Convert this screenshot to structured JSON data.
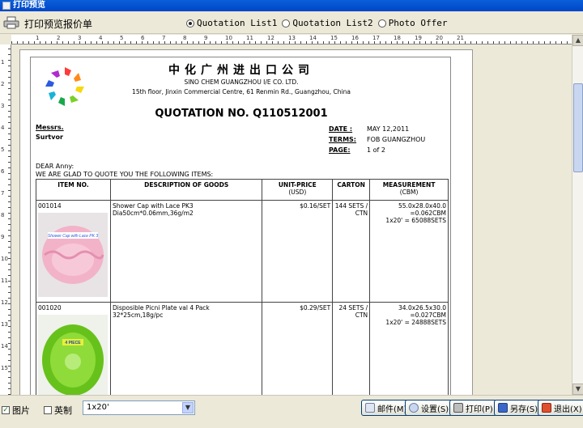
{
  "window": {
    "title": "打印预览"
  },
  "toolbar": {
    "app_label": "打印预览报价单",
    "options": [
      {
        "label": "Quotation List1",
        "selected": true
      },
      {
        "label": "Quotation List2",
        "selected": false
      },
      {
        "label": "Photo Offer",
        "selected": false
      }
    ]
  },
  "rulers": {
    "top": [
      "1",
      "2",
      "3",
      "4",
      "5",
      "6",
      "7",
      "8",
      "9",
      "10",
      "11",
      "12",
      "13",
      "14",
      "15",
      "16",
      "17",
      "18",
      "19",
      "20",
      "21"
    ],
    "left": [
      "1",
      "2",
      "3",
      "4",
      "5",
      "6",
      "7",
      "8",
      "9",
      "10",
      "11",
      "12",
      "13",
      "14",
      "15"
    ]
  },
  "document": {
    "company_cn": "中化广州进出口公司",
    "company_en": "SINO CHEM GUANGZHOU I/E CO. LTD.",
    "address": "15th floor, Jinxin Commercial Centre, 61 Renmin Rd., Guangzhou, China",
    "title": "QUOTATION NO. Q110512001",
    "messrs_label": "Messrs.",
    "customer": "Surtvor",
    "date_label": "DATE :",
    "date_value": "MAY 12,2011",
    "terms_label": "TERMS:",
    "terms_value": "FOB GUANGZHOU",
    "page_label": "PAGE:",
    "page_value": "1 of 2",
    "greeting": "DEAR Anny:",
    "intro": "WE ARE GLAD TO QUOTE YOU THE FOLLOWING ITEMS:",
    "columns": {
      "item": "ITEM NO.",
      "desc": "DESCRIPTION OF GOODS",
      "price": "UNIT-PRICE",
      "price_unit": "(USD)",
      "carton": "CARTON",
      "measure": "MEASUREMENT",
      "measure_unit": "(CBM)"
    },
    "items": [
      {
        "item_no": "001014",
        "desc1": "Shower Cap with Lace PK3",
        "desc2": "Dia50cm*0.06mm,36g/m2",
        "price": "$0.16/SET",
        "carton1": "144 SETS /",
        "carton2": "CTN",
        "m1": "55.0x28.0x40.0",
        "m2": "=0.062CBM",
        "m3": "1x20' = 65088SETS",
        "photo_text": "Shower Cap with Lace PK 3"
      },
      {
        "item_no": "001020",
        "desc1": "Disposible Picni  Plate val 4 Pack",
        "desc2": "32*25cm,18g/pc",
        "price": "$0.29/SET",
        "carton1": "24 SETS /",
        "carton2": "CTN",
        "m1": "34.0x26.5x30.0",
        "m2": "=0.027CBM",
        "m3": "1x20' = 24888SETS",
        "photo_text": "4 PIECE"
      }
    ]
  },
  "bottom": {
    "check_pictures": {
      "label": "图片",
      "checked": true
    },
    "check_imperial": {
      "label": "英制",
      "checked": false
    },
    "container_select": "1x20'",
    "buttons": {
      "email": "邮件(M)",
      "settings": "设置(S)",
      "print": "打印(P)",
      "save_as": "另存(S)",
      "exit": "退出(X)"
    }
  }
}
